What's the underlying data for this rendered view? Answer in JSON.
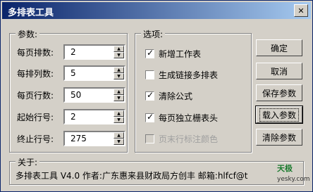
{
  "window": {
    "title": "多排表工具",
    "close_glyph": "✕"
  },
  "params": {
    "label": "参数:",
    "fields": [
      {
        "label": "每页排数:",
        "value": "2"
      },
      {
        "label": "每排列数:",
        "value": "5"
      },
      {
        "label": "每页行数:",
        "value": "50"
      },
      {
        "label": "起始行号:",
        "value": "2"
      },
      {
        "label": "终止行号:",
        "value": "275"
      }
    ]
  },
  "options": {
    "label": "选项:",
    "items": [
      {
        "label": "新增工作表",
        "checked": true,
        "enabled": true
      },
      {
        "label": "生成链接多排表",
        "checked": false,
        "enabled": true
      },
      {
        "label": "清除公式",
        "checked": true,
        "enabled": true
      },
      {
        "label": "每页独立栅表头",
        "checked": true,
        "enabled": true
      },
      {
        "label": "页末行标注颜色",
        "checked": false,
        "enabled": false
      }
    ]
  },
  "buttons": {
    "ok": "确定",
    "cancel": "取消",
    "save": "保存参数",
    "load": "载入参数",
    "clear": "清除参数"
  },
  "about": {
    "label": "关于:",
    "text": "多排表工具 V4.0  作者:广东惠来县财政局方创丰  邮箱:hlfcf@t"
  },
  "watermark": {
    "brand": "天极",
    "site": "yesky.com"
  }
}
